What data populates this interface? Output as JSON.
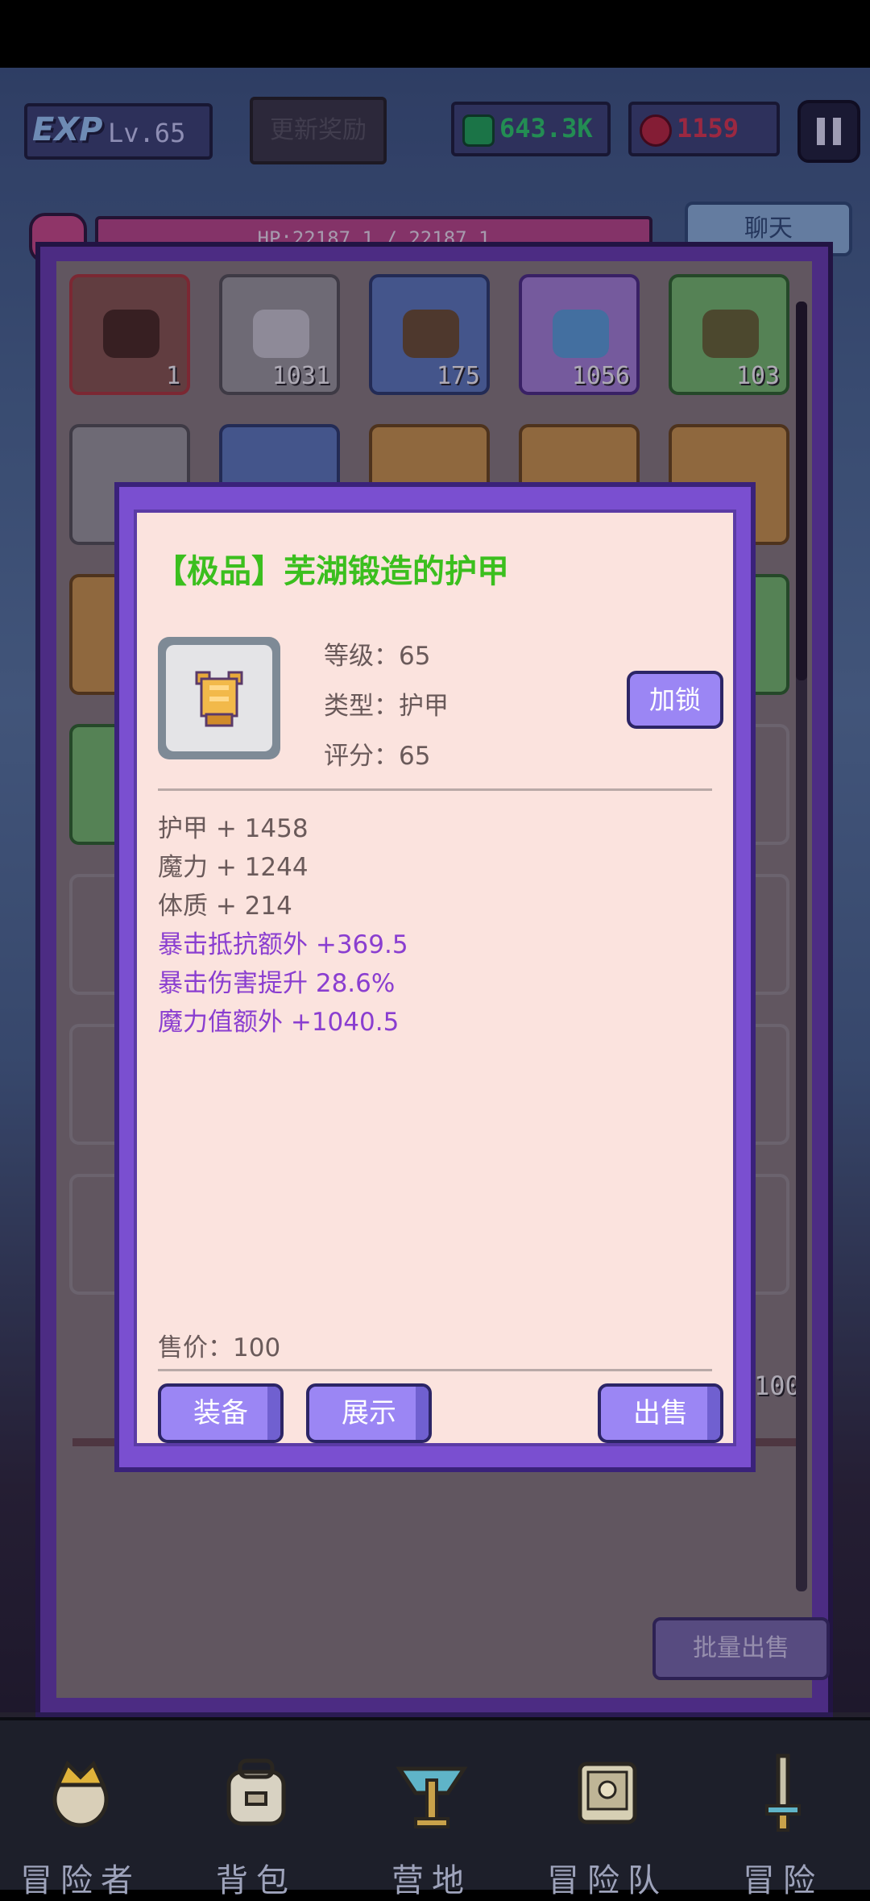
{
  "hud": {
    "exp_logo": "EXP",
    "level": "Lv.65",
    "reward_label": "更新奖励",
    "gems": "643.3K",
    "gem_color": "#1fae58",
    "rubies": "1159",
    "ruby_color": "#c0283c",
    "hp_text": "HP:22187.1 / 22187.1",
    "chat_label": "聊天"
  },
  "bag": {
    "slots": [
      {
        "count": "1",
        "rarity_color": "#b23a3a",
        "icon": "chest-icon"
      },
      {
        "count": "1031",
        "rarity_color": "#9a9a9a",
        "icon": "ore-icon"
      },
      {
        "count": "175",
        "rarity_color": "#4c6fbd",
        "icon": "ore-icon"
      },
      {
        "count": "1056",
        "rarity_color": "#9b6ad8",
        "icon": "crystal-icon"
      },
      {
        "count": "103",
        "rarity_color": "#63b65a",
        "icon": "herb-icon"
      }
    ],
    "partial_count": "100",
    "bulk_sell_label": "批量出售"
  },
  "modal": {
    "title": "【极品】芜湖锻造的护甲",
    "level_line": "等级：65",
    "type_line": "类型：护甲",
    "score_line": "评分：65",
    "lock_label": "加锁",
    "base_stats": [
      "护甲 + 1458",
      "魔力 + 1244",
      "体质 + 214"
    ],
    "extra_stats": [
      "暴击抵抗额外 +369.5",
      "暴击伤害提升 28.6%",
      "魔力值额外 +1040.5"
    ],
    "price_line": "售价：100",
    "equip_label": "装备",
    "show_label": "展示",
    "sell_label": "出售",
    "title_color": "#3bbf1e",
    "extra_color": "#8a3ed0",
    "button_color": "#9b86f4"
  },
  "nav": {
    "items": [
      {
        "label": "冒险者",
        "icon": "adventurer-icon"
      },
      {
        "label": "背包",
        "icon": "backpack-icon"
      },
      {
        "label": "营地",
        "icon": "camp-icon"
      },
      {
        "label": "冒险队",
        "icon": "team-book-icon"
      },
      {
        "label": "冒险",
        "icon": "sword-icon"
      }
    ]
  }
}
